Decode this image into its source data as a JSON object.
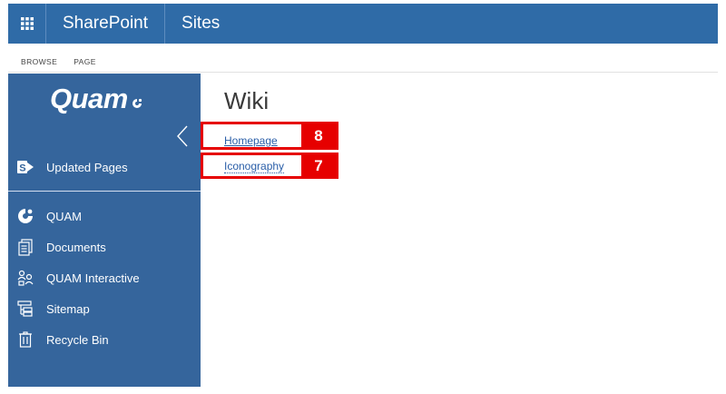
{
  "suitebar": {
    "app_name": "SharePoint",
    "section": "Sites",
    "color": "#2f6ba7"
  },
  "ribbon": {
    "tabs": [
      "BROWSE",
      "PAGE"
    ]
  },
  "leftnav": {
    "logo_text": "Quam",
    "background": "#35659c",
    "top_item": {
      "label": "Updated Pages",
      "icon": "sharepoint-s-icon"
    },
    "items": [
      {
        "label": "QUAM",
        "icon": "quam-logo-icon"
      },
      {
        "label": "Documents",
        "icon": "documents-icon"
      },
      {
        "label": "QUAM Interactive",
        "icon": "interactive-icon"
      },
      {
        "label": "Sitemap",
        "icon": "sitemap-icon"
      },
      {
        "label": "Recycle Bin",
        "icon": "recycle-bin-icon"
      }
    ]
  },
  "main": {
    "title": "Wiki",
    "links": [
      {
        "label": "Homepage",
        "badge": "8"
      },
      {
        "label": "Iconography",
        "badge": "7"
      }
    ],
    "highlight_color": "#e60000"
  }
}
